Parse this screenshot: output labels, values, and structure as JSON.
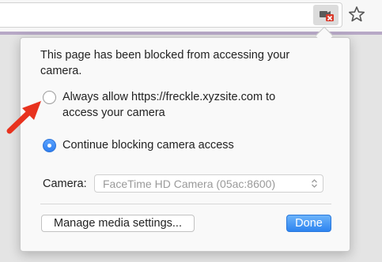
{
  "toolbar": {
    "address_bar": "",
    "camera_blocked_icon": "camera-blocked-icon",
    "bookmark_icon": "star-icon"
  },
  "popup": {
    "message": "This page has been blocked from accessing your camera.",
    "options": [
      {
        "label": "Always allow https://freckle.xyzsite.com to access your camera",
        "selected": false
      },
      {
        "label": "Continue blocking camera access",
        "selected": true
      }
    ],
    "camera_label": "Camera:",
    "camera_value": "FaceTime HD Camera (05ac:8600)",
    "manage_button": "Manage media settings...",
    "done_button": "Done"
  },
  "annotation": {
    "arrow_color": "#e8321e"
  },
  "colors": {
    "accent_blue": "#2d84f0",
    "strip_purple": "#b7a8c6"
  }
}
